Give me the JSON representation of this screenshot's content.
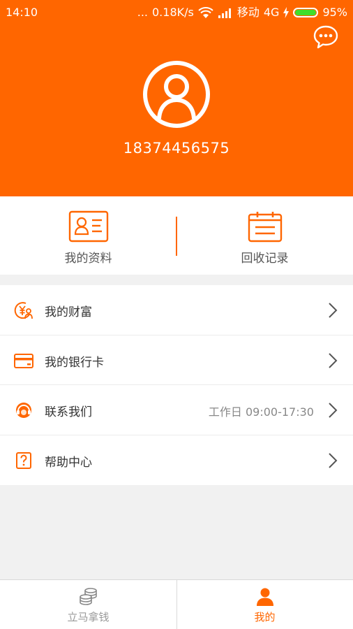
{
  "status_bar": {
    "time": "14:10",
    "signal_dots": "...",
    "speed": "0.18K/s",
    "wifi_icon": "wifi-icon",
    "carrier": "移动",
    "network": "4G",
    "battery": "95%"
  },
  "header": {
    "chat_icon": "chat-bubble-icon",
    "avatar_icon": "user-avatar-icon",
    "phone": "18374456575"
  },
  "quick": {
    "profile_label": "我的资料",
    "records_label": "回收记录"
  },
  "menu": [
    {
      "label": "我的财富",
      "icon": "wealth-icon",
      "extra": ""
    },
    {
      "label": "我的银行卡",
      "icon": "bank-card-icon",
      "extra": ""
    },
    {
      "label": "联系我们",
      "icon": "customer-service-icon",
      "extra": "工作日 09:00-17:30"
    },
    {
      "label": "帮助中心",
      "icon": "help-icon",
      "extra": ""
    }
  ],
  "tabbar": {
    "tab1_label": "立马拿钱",
    "tab2_label": "我的",
    "active": "我的"
  },
  "colors": {
    "accent": "#ff6600",
    "inactive_tab": "#999999",
    "battery": "#3fdd2b"
  }
}
